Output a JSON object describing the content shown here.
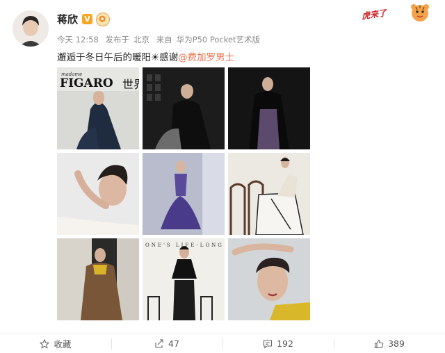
{
  "user": {
    "name": "蒋欣",
    "verified_mark": "V"
  },
  "meta": {
    "time": "今天 12:58",
    "source_prefix": "发布于",
    "location": "北京",
    "device_prefix": "来自",
    "device": "华为P50 Pocket艺术版"
  },
  "post": {
    "text": "邂逅于冬日午后的暖阳☀感谢",
    "mention": "@费加罗男士"
  },
  "sticker": {
    "text": "虎来了"
  },
  "photos": [
    {
      "overlay_title": "FIGARO",
      "overlay_subtitle": "世界",
      "overlay_tag": "madame"
    },
    {},
    {},
    {},
    {},
    {},
    {},
    {
      "overlay_text": "ONE'S LIFE-LONG"
    },
    {}
  ],
  "actions": {
    "favorite_label": "收藏",
    "repost_count": "47",
    "comment_count": "192",
    "like_count": "389"
  },
  "colors": {
    "mention": "#eb7350",
    "meta": "#8a8a8a",
    "vip": "#f5a623"
  }
}
